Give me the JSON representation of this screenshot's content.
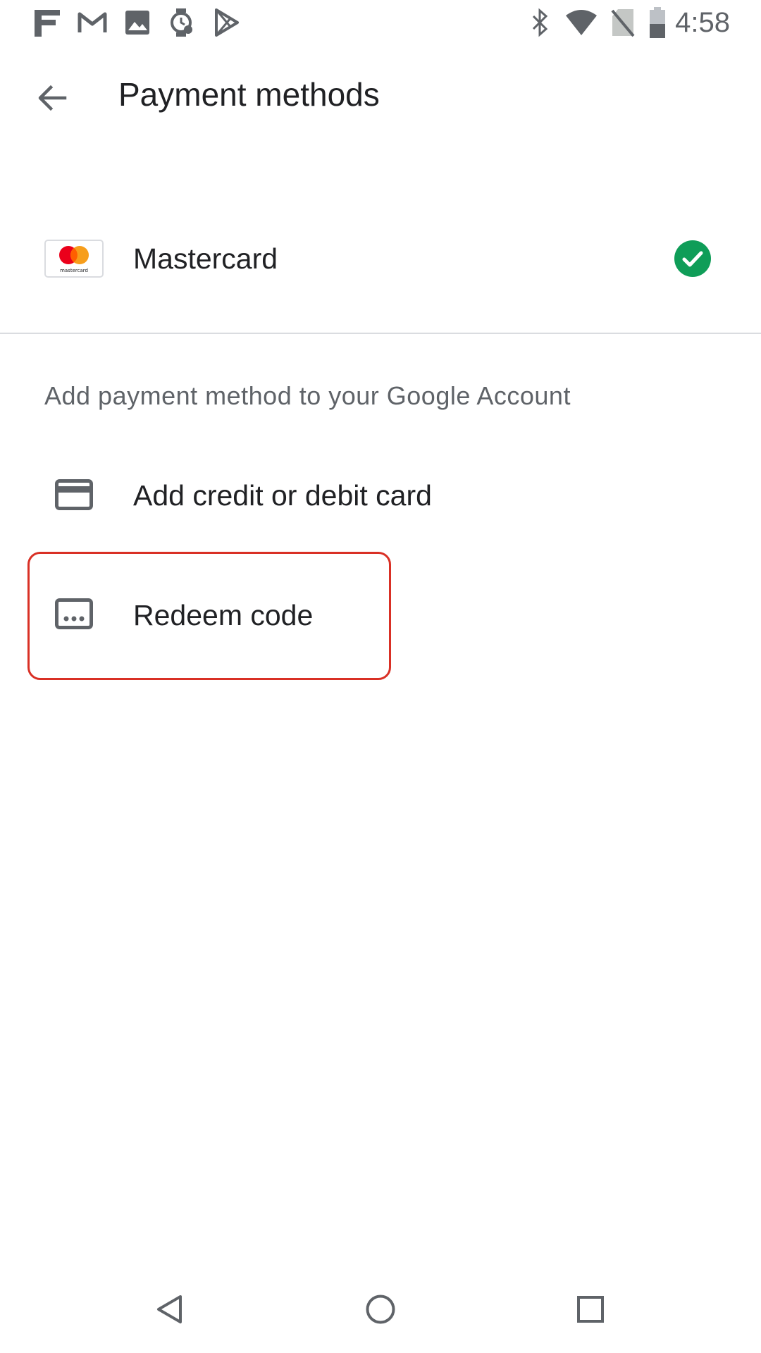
{
  "status_bar": {
    "time": "4:58",
    "left_icons": [
      "fitness-icon",
      "gmail-icon",
      "photos-icon",
      "watch-icon",
      "play-store-icon"
    ],
    "right_icons": [
      "bluetooth-icon",
      "wifi-icon",
      "no-sim-icon",
      "battery-icon"
    ]
  },
  "app_bar": {
    "title": "Payment methods",
    "back_icon": "arrow-back-icon"
  },
  "payment_methods": [
    {
      "label": "Mastercard",
      "logo_text": "mastercard",
      "selected": true
    }
  ],
  "add_section": {
    "header": "Add payment method to your Google Account",
    "items": [
      {
        "label": "Add credit or debit card",
        "icon": "credit-card-icon"
      },
      {
        "label": "Redeem code",
        "icon": "redeem-code-icon",
        "highlighted": true
      }
    ]
  },
  "nav_bar": {
    "buttons": [
      "back-triangle-icon",
      "home-circle-icon",
      "recents-square-icon"
    ]
  },
  "colors": {
    "selected_check": "#0f9d58",
    "highlight_border": "#d93025",
    "title_text": "#202124",
    "secondary_text": "#5f6368"
  }
}
